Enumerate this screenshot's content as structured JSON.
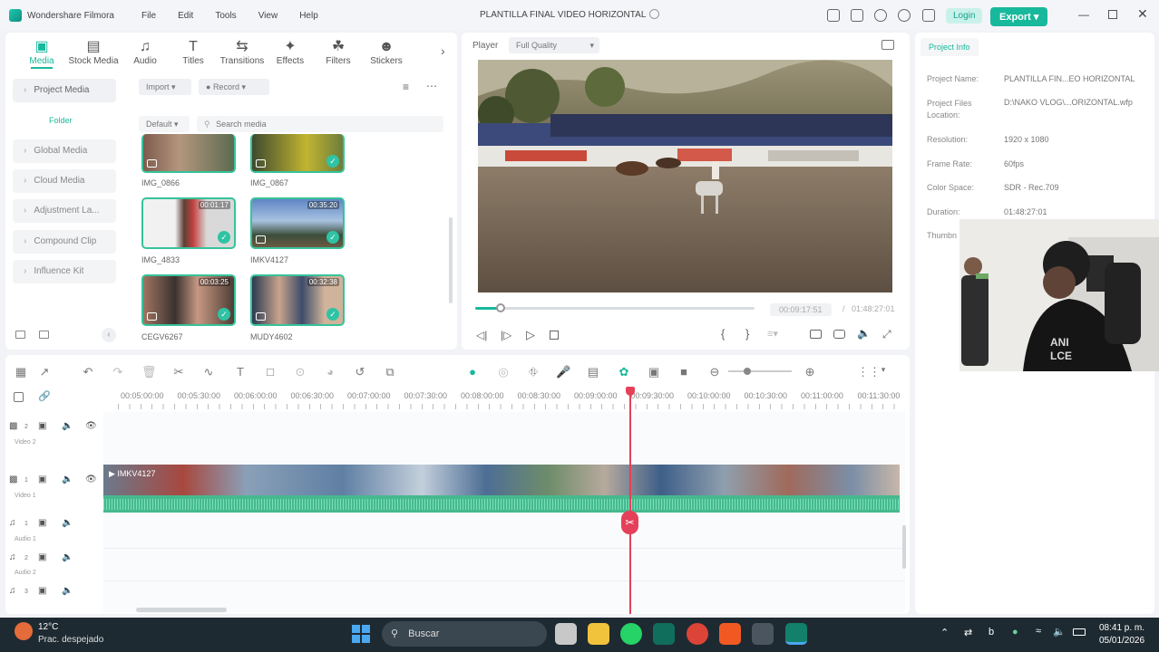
{
  "app": {
    "name": "Wondershare Filmora",
    "menu": [
      "File",
      "Edit",
      "Tools",
      "View",
      "Help"
    ],
    "project_title": "PLANTILLA FINAL VIDEO HORIZONTAL",
    "login_label": "Login",
    "export_label": "Export"
  },
  "media_tabs": [
    {
      "label": "Media",
      "icon": "media-icon"
    },
    {
      "label": "Stock Media",
      "icon": "stock-media-icon"
    },
    {
      "label": "Audio",
      "icon": "music-note-icon"
    },
    {
      "label": "Titles",
      "icon": "text-icon"
    },
    {
      "label": "Transitions",
      "icon": "transitions-icon"
    },
    {
      "label": "Effects",
      "icon": "effects-icon"
    },
    {
      "label": "Filters",
      "icon": "filters-icon"
    },
    {
      "label": "Stickers",
      "icon": "stickers-icon"
    }
  ],
  "sidebar": {
    "project_media": "Project Media",
    "folder": "Folder",
    "items": [
      "Global Media",
      "Cloud Media",
      "Adjustment La...",
      "Compound Clip",
      "Influence Kit"
    ]
  },
  "library": {
    "import_label": "Import",
    "record_label": "Record",
    "sort_label": "Default",
    "search_placeholder": "Search media",
    "clips": [
      {
        "name": "IMG_0866",
        "duration": ""
      },
      {
        "name": "IMG_0867",
        "duration": ""
      },
      {
        "name": "IMG_4833",
        "duration": "00:01:17"
      },
      {
        "name": "IMKV4127",
        "duration": "00:35:20"
      },
      {
        "name": "CEGV6267",
        "duration": "00:03:25"
      },
      {
        "name": "MUDY4602",
        "duration": "00:32:38"
      }
    ]
  },
  "player": {
    "label": "Player",
    "quality": "Full Quality",
    "current_time": "00:09:17:51",
    "separator": "/",
    "total_time": "01:48:27:01",
    "progress": 0.09
  },
  "project_info": {
    "tab": "Project Info",
    "fields": [
      {
        "key": "Project Name:",
        "value": "PLANTILLA FIN...EO HORIZONTAL"
      },
      {
        "key": "Project Files Location:",
        "value": "D:\\NAKO VLOG\\...ORIZONTAL.wfp"
      },
      {
        "key": "Resolution:",
        "value": "1920 x 1080"
      },
      {
        "key": "Frame Rate:",
        "value": "60fps"
      },
      {
        "key": "Color Space:",
        "value": "SDR - Rec.709"
      },
      {
        "key": "Duration:",
        "value": "01:48:27:01"
      },
      {
        "key": "Thumbn",
        "value": ""
      }
    ]
  },
  "timeline": {
    "ruler": [
      "00:05:00:00",
      "00:05:30:00",
      "00:06:00:00",
      "00:06:30:00",
      "00:07:00:00",
      "00:07:30:00",
      "00:08:00:00",
      "00:08:30:00",
      "00:09:00:00",
      "00:09:30:00",
      "00:10:00:00",
      "00:10:30:00",
      "00:11:00:00",
      "00:11:30:00"
    ],
    "tracks": [
      {
        "num": "2",
        "name": "Video 2"
      },
      {
        "num": "1",
        "name": "Video 1"
      },
      {
        "num": "1",
        "name": "Audio 1"
      },
      {
        "num": "2",
        "name": "Audio 2"
      },
      {
        "num": "3",
        "name": ""
      }
    ],
    "clip_name": "IMKV4127"
  },
  "taskbar": {
    "temperature": "12°C",
    "weather": "Prac. despejado",
    "search": "Buscar",
    "time": "08:41 p. m.",
    "date": "05/01/2026"
  },
  "colors": {
    "accent": "#18b89c",
    "playhead": "#e5405a",
    "waveform": "#4ec9a0"
  }
}
